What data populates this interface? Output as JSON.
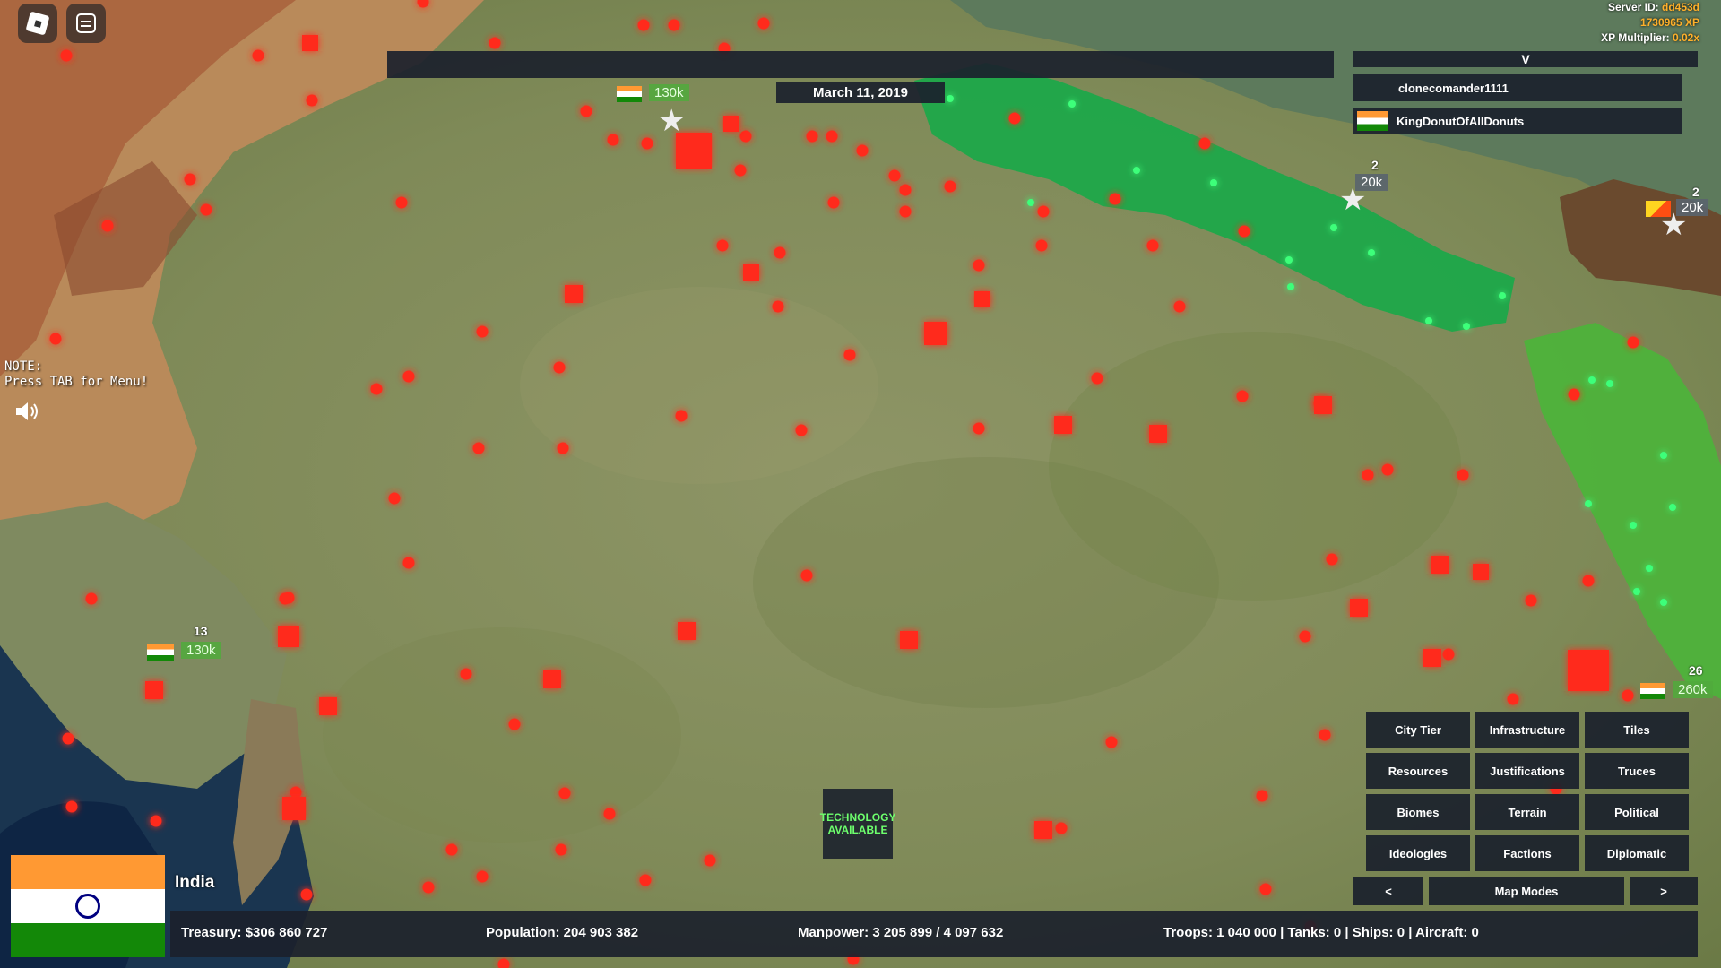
{
  "server": {
    "id_label": "Server ID:",
    "id": "dd453d",
    "xp": "1730965 XP",
    "mult_label": "XP Multiplier:",
    "mult": "0.02x"
  },
  "date": "March 11, 2019",
  "players": {
    "header": "V",
    "list": [
      {
        "name": "clonecomander1111",
        "flag": false
      },
      {
        "name": "KingDonutOfAllDonuts",
        "flag": true
      }
    ]
  },
  "note": "NOTE:\nPress TAB for Menu!",
  "units": [
    {
      "count": "",
      "strength": "130k",
      "flag": "india"
    },
    {
      "count": "13",
      "strength": "130k",
      "flag": "india"
    },
    {
      "count": "2",
      "strength": "20k",
      "flag": "none"
    },
    {
      "count": "2",
      "strength": "20k",
      "flag": "bhutan"
    },
    {
      "count": "26",
      "strength": "260k",
      "flag": "india"
    }
  ],
  "tech": "TECHNOLOGY AVAILABLE",
  "map_modes": {
    "buttons": [
      "City Tier",
      "Infrastructure",
      "Tiles",
      "Resources",
      "Justifications",
      "Truces",
      "Biomes",
      "Terrain",
      "Political",
      "Ideologies",
      "Factions",
      "Diplomatic"
    ],
    "label": "Map Modes",
    "prev": "<",
    "next": ">"
  },
  "country": {
    "name": "India"
  },
  "stats": {
    "treasury": "Treasury:  $306 860 727",
    "population": "Population: 204 903 382",
    "manpower": "Manpower:  3 205 899  /  4 097 632",
    "troops": "Troops: 1 040 000  |  Tanks: 0  |  Ships: 0  |  Aircraft: 0"
  },
  "colors": {
    "panel": "#1b212c",
    "city": "#ff2a1a",
    "nepal": "#1ea84a",
    "accent": "#ffb02a"
  }
}
